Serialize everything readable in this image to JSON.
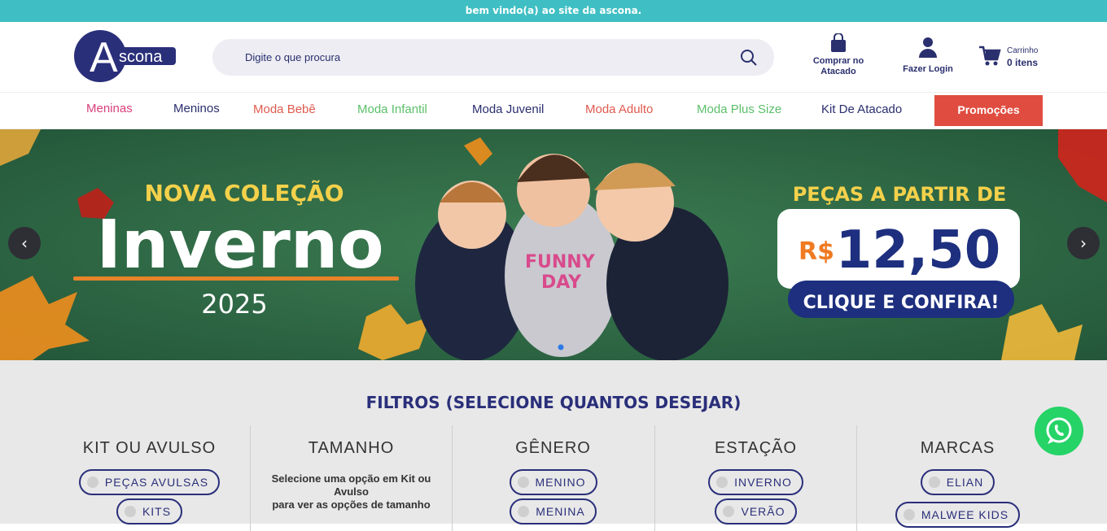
{
  "topbar": {
    "text": "bem vindo(a) ao site da ascona."
  },
  "header": {
    "logo_text": "scona",
    "logo_letter": "A",
    "search_placeholder": "Digite o que procura",
    "wholesale_line1": "Comprar no",
    "wholesale_line2": "Atacado",
    "login_label": "Fazer Login",
    "cart_label": "Carrinho",
    "cart_count": "0 itens"
  },
  "nav": {
    "items": [
      {
        "label": "Meninas",
        "color": "#d9407a"
      },
      {
        "label": "Meninos",
        "color": "#2a2f6e"
      },
      {
        "label": "Moda Bebê",
        "color": "#e05a4e"
      },
      {
        "label": "Moda Infantil",
        "color": "#5bbf6a"
      },
      {
        "label": "Moda Juvenil",
        "color": "#2a2f6e"
      },
      {
        "label": "Moda Adulto",
        "color": "#e05a4e"
      },
      {
        "label": "Moda Plus Size",
        "color": "#5bbf6a"
      },
      {
        "label": "Kit De Atacado",
        "color": "#2a2f6e"
      }
    ],
    "promo_label": "Promoções",
    "promo_color": "#e04d40"
  },
  "banner": {
    "headline_small": "NOVA COLEÇÃO",
    "headline_big": "Inverno",
    "year": "2025",
    "price_intro": "PEÇAS A PARTIR DE",
    "currency": "R$",
    "price": "12,50",
    "cta": "CLIQUE E CONFIRA!",
    "shirt_text_1": "FUNNY",
    "shirt_text_2": "DAY",
    "prev_label": "‹",
    "next_label": "›"
  },
  "filters": {
    "title": "FILTROS (SELECIONE QUANTOS DESEJAR)",
    "kit": {
      "title": "KIT OU AVULSO",
      "options": [
        "PEÇAS AVULSAS",
        "KITS"
      ]
    },
    "tamanho": {
      "title": "TAMANHO",
      "note_1": "Selecione uma opção em Kit ou",
      "note_2": "Avulso",
      "note_3": "para ver as opções de tamanho"
    },
    "genero": {
      "title": "GÊNERO",
      "options": [
        "MENINO",
        "MENINA"
      ]
    },
    "estacao": {
      "title": "ESTAÇÃO",
      "options": [
        "INVERNO",
        "VERÃO"
      ]
    },
    "marcas": {
      "title": "MARCAS",
      "options": [
        "ELIAN",
        "MALWEE KIDS"
      ]
    }
  }
}
